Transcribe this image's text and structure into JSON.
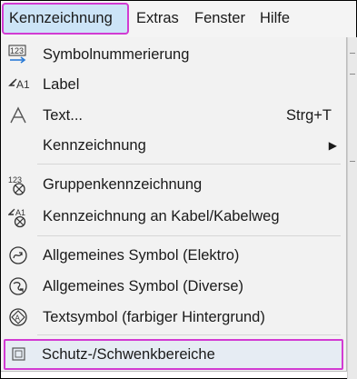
{
  "menubar": {
    "items": [
      {
        "label": "Kennzeichnung",
        "active": true
      },
      {
        "label": "Extras"
      },
      {
        "label": "Fenster"
      },
      {
        "label": "Hilfe"
      }
    ]
  },
  "dropdown": {
    "items": [
      {
        "label": "Symbolnummerierung",
        "icon": "symbol-numbering-icon"
      },
      {
        "label": "Label",
        "icon": "label-icon"
      },
      {
        "label": "Text...",
        "shortcut": "Strg+T",
        "icon": "text-icon"
      },
      {
        "label": "Kennzeichnung",
        "submenu": true
      },
      {
        "label": "Gruppenkennzeichnung",
        "icon": "group-marking-icon"
      },
      {
        "label": "Kennzeichnung an Kabel/Kabelweg",
        "icon": "cable-marking-icon"
      },
      {
        "label": "Allgemeines Symbol (Elektro)",
        "icon": "general-symbol-electro-icon"
      },
      {
        "label": "Allgemeines Symbol (Diverse)",
        "icon": "general-symbol-misc-icon"
      },
      {
        "label": "Textsymbol (farbiger Hintergrund)",
        "icon": "text-symbol-icon"
      },
      {
        "label": "Schutz-/Schwenkbereiche",
        "icon": "protection-zone-icon",
        "highlighted": true
      }
    ]
  },
  "colors": {
    "highlight_border": "#d23bd2",
    "active_menu_bg": "#cce4f7",
    "menu_bg": "#f2f2f2"
  }
}
